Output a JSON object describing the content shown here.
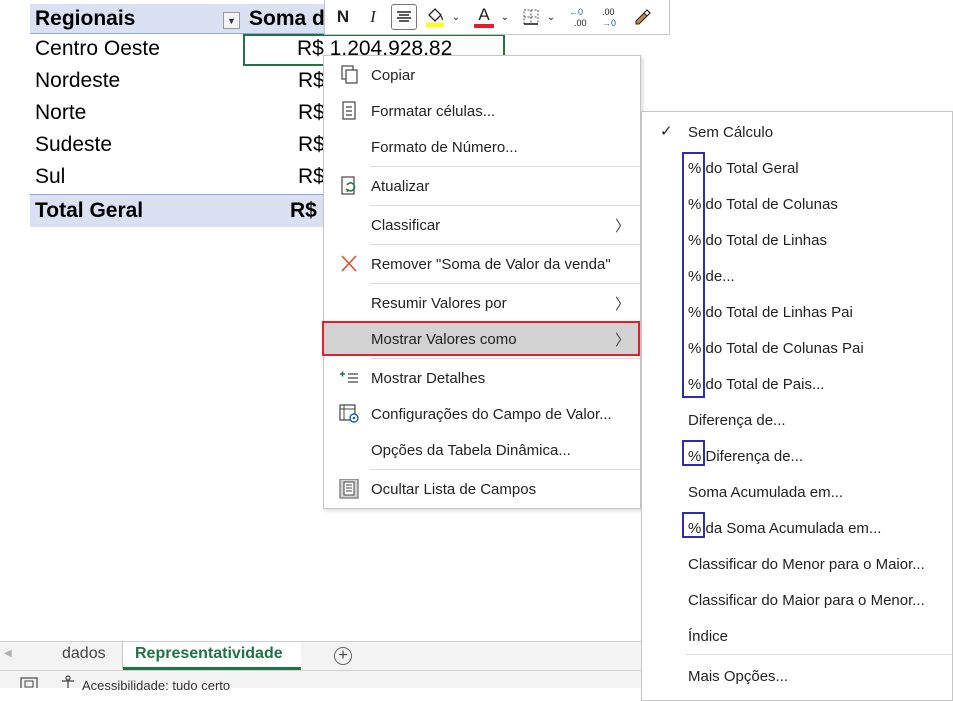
{
  "pivot": {
    "col1_header": "Regionais",
    "col2_header": "Soma d",
    "rows": [
      {
        "label": "Centro Oeste",
        "value": "R$ 1.204.928,82"
      },
      {
        "label": "Nordeste",
        "value": "R$"
      },
      {
        "label": "Norte",
        "value": "R$"
      },
      {
        "label": "Sudeste",
        "value": "R$"
      },
      {
        "label": "Sul",
        "value": "R$"
      }
    ],
    "total_label": "Total Geral",
    "total_value": "R$"
  },
  "mini_toolbar": {
    "bold": "N",
    "italic": "I",
    "font_color_letter": "A",
    "dec_increase": "←0 .00",
    "dec_decrease": ".00 →0",
    "font_color_hex": "#e0202c",
    "highlight_hex": "#ffff00"
  },
  "context_menu": {
    "items": [
      {
        "label": "Copiar",
        "icon": "copy-icon"
      },
      {
        "label": "Formatar células...",
        "icon": "format-cells-icon"
      },
      {
        "label": "Formato de Número...",
        "icon": ""
      },
      {
        "label": "Atualizar",
        "icon": "refresh-icon"
      },
      {
        "label": "Classificar",
        "icon": "",
        "submenu": true
      },
      {
        "label": "Remover \"Soma de Valor da venda\"",
        "icon": "remove-x-icon"
      },
      {
        "label": "Resumir Valores por",
        "icon": "",
        "submenu": true
      },
      {
        "label": "Mostrar Valores como",
        "icon": "",
        "submenu": true,
        "highlighted": true
      },
      {
        "label": "Mostrar Detalhes",
        "icon": "show-details-icon"
      },
      {
        "label": "Configurações do Campo de Valor...",
        "icon": "field-settings-icon"
      },
      {
        "label": "Opções da Tabela Dinâmica...",
        "icon": ""
      },
      {
        "label": "Ocultar Lista de Campos",
        "icon": "field-list-icon"
      }
    ]
  },
  "submenu": {
    "items": [
      {
        "label": "Sem Cálculo",
        "checked": true
      },
      {
        "label": "% do Total Geral"
      },
      {
        "label": "% do Total de Colunas"
      },
      {
        "label": "% do Total de Linhas"
      },
      {
        "label": "% de..."
      },
      {
        "label": "% do Total de Linhas Pai"
      },
      {
        "label": "% do Total de Colunas Pai"
      },
      {
        "label": "% do Total de Pais..."
      },
      {
        "label": "Diferença de..."
      },
      {
        "label": "% Diferença de..."
      },
      {
        "label": "Soma Acumulada em..."
      },
      {
        "label": "% da Soma Acumulada em..."
      },
      {
        "label": "Classificar do Menor para o Maior..."
      },
      {
        "label": "Classificar do Maior para o Menor..."
      },
      {
        "label": "Índice"
      },
      {
        "label": "Mais Opções..."
      }
    ],
    "checkmark": "✓"
  },
  "sheet_tabs": {
    "tabs": [
      "dados",
      "Representatividade"
    ],
    "active": "Representatividade",
    "add_symbol": "+"
  },
  "status": {
    "accessibility": "Acessibilidade: tudo certo"
  },
  "colors": {
    "excel_green": "#217346",
    "pivot_header_bg": "#d9e1f2",
    "highlight_red": "#e0202c",
    "pct_box_blue": "#2e2ea8"
  }
}
